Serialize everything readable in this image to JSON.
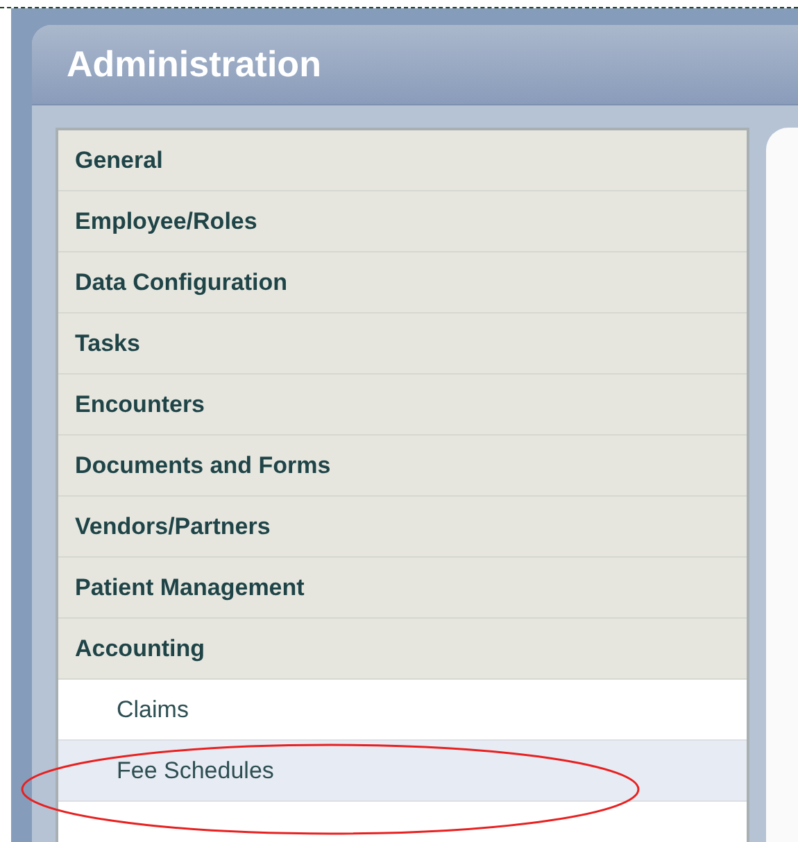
{
  "panel": {
    "title": "Administration"
  },
  "menu": [
    {
      "label": "General"
    },
    {
      "label": "Employee/Roles"
    },
    {
      "label": "Data Configuration"
    },
    {
      "label": "Tasks"
    },
    {
      "label": "Encounters"
    },
    {
      "label": "Documents and Forms"
    },
    {
      "label": "Vendors/Partners"
    },
    {
      "label": "Patient Management"
    },
    {
      "label": "Accounting",
      "children": [
        {
          "label": "Claims",
          "selected": false
        },
        {
          "label": "Fee Schedules",
          "selected": true
        }
      ]
    }
  ]
}
